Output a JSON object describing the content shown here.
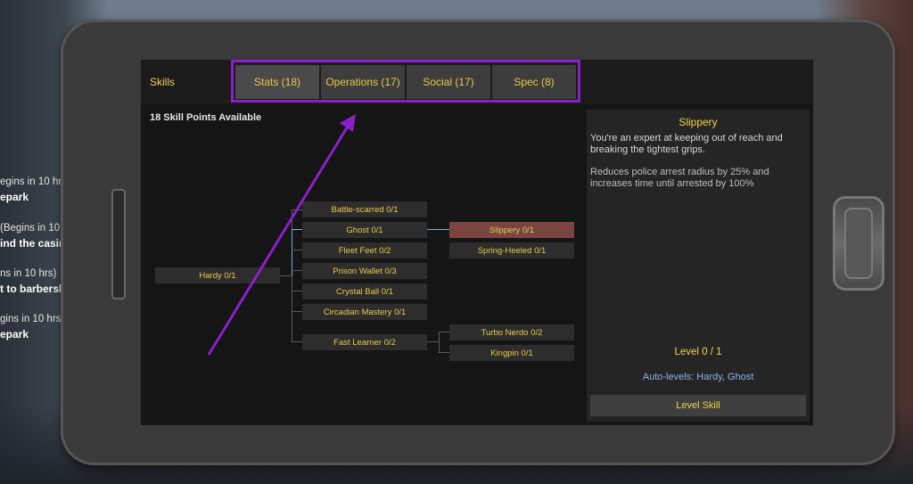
{
  "hud": {
    "quests": [
      {
        "line1": "egins in 10 hrs)",
        "line2": "epark"
      },
      {
        "line1": "(Begins in 10 hrs)",
        "line2": "ind the casino"
      },
      {
        "line1": "ns in 10 hrs)",
        "line2": "t to barbershop"
      },
      {
        "line1": "gins in 10 hrs)",
        "line2": "epark"
      }
    ]
  },
  "skills": {
    "header_label": "Skills",
    "tabs": [
      {
        "label": "Stats (18)",
        "active": true
      },
      {
        "label": "Operations (17)",
        "active": false
      },
      {
        "label": "Social (17)",
        "active": false
      },
      {
        "label": "Spec (8)",
        "active": false
      }
    ],
    "points_label": "18 Skill Points Available",
    "tree": {
      "root": "Hardy 0/1",
      "tier1": [
        "Battle-scarred 0/1",
        "Ghost 0/1",
        "Fleet Feet 0/2",
        "Prison Wallet 0/3",
        "Crystal Ball 0/1",
        "Circadian Mastery 0/1",
        "Fast Learner 0/2"
      ],
      "tier2": [
        "Slippery 0/1",
        "Spring-Heeled 0/1",
        "Turbo Nerdo 0/2",
        "Kingpin 0/1"
      ]
    },
    "detail": {
      "title": "Slippery",
      "description": "You're an expert at keeping out of reach and breaking the tightest grips.",
      "effect": "Reduces police arrest radius by 25% and increases time until arrested by 100%",
      "level": "Level 0 / 1",
      "auto_levels": "Auto-levels: Hardy, Ghost",
      "level_button": "Level Skill"
    }
  },
  "colors": {
    "accent_yellow": "#f2d24b",
    "highlight_purple": "#8b1fc9",
    "selected_node": "#7a4540",
    "auto_levels_blue": "#8fb3e0"
  }
}
